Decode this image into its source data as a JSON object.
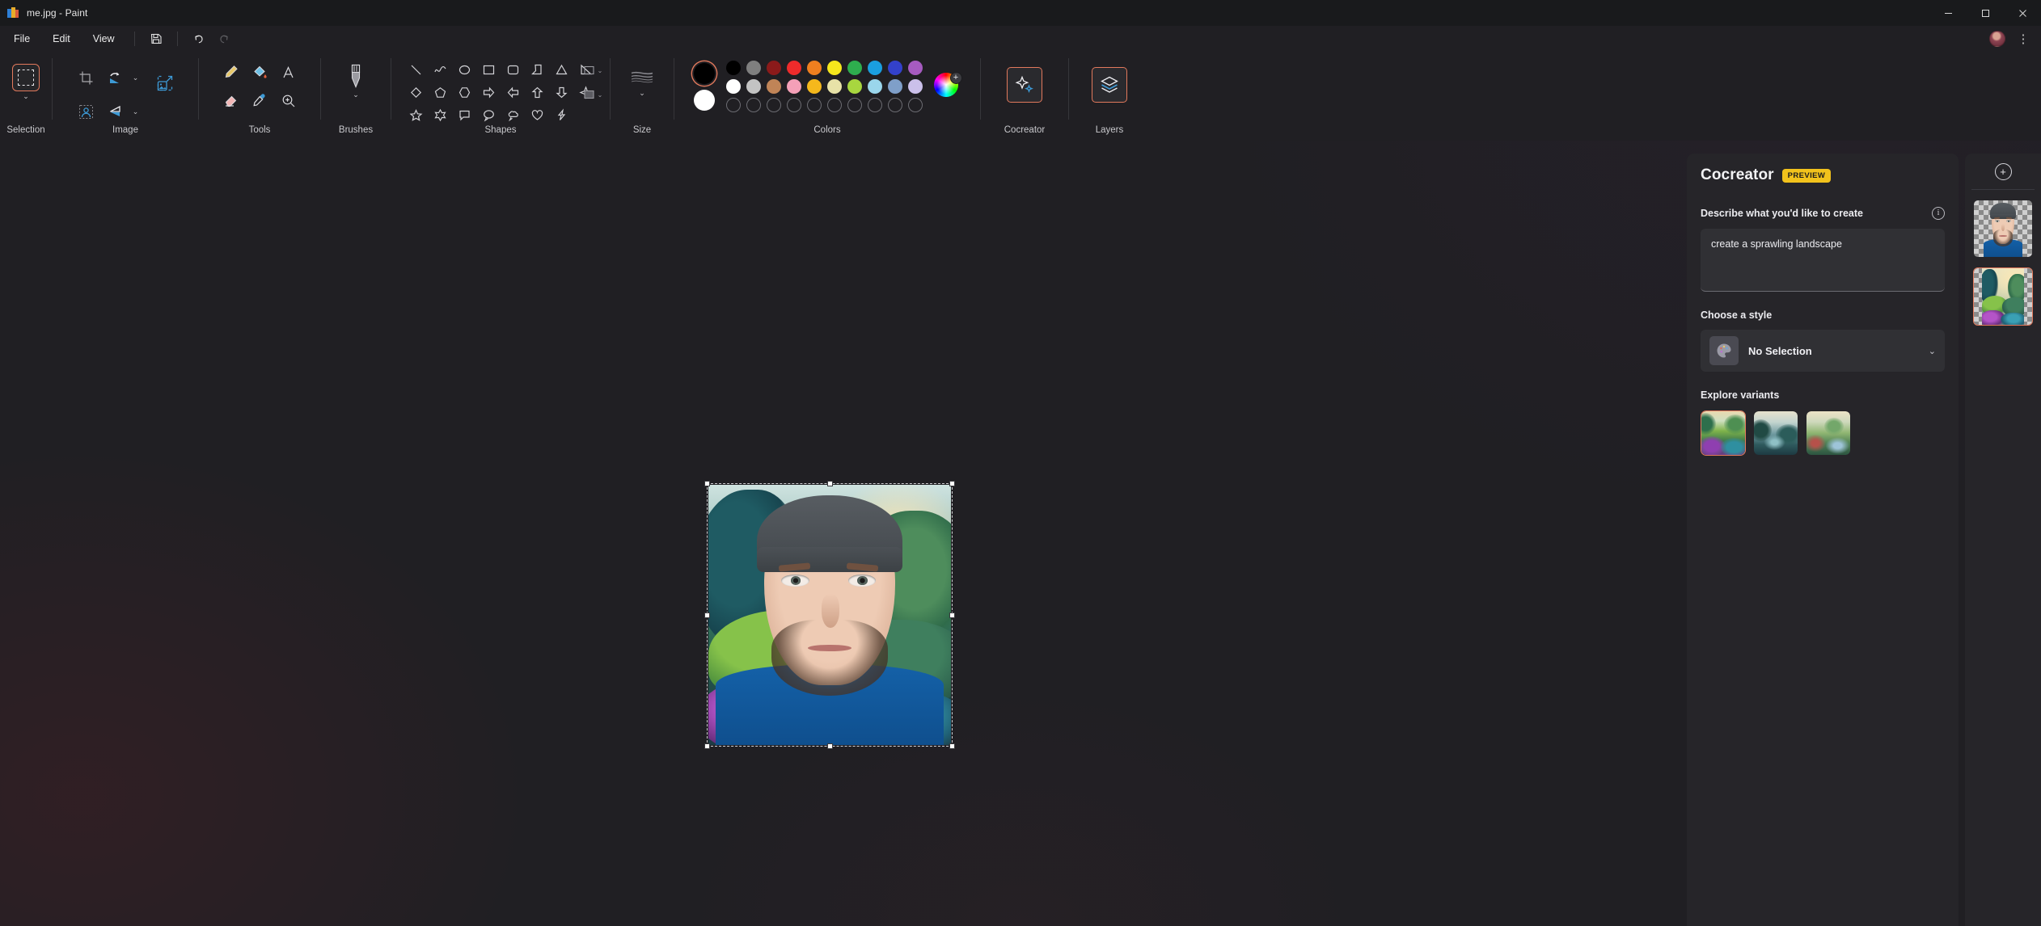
{
  "window": {
    "title": "me.jpg - Paint",
    "app_icon": "paint-icon",
    "controls": [
      {
        "name": "minimize",
        "glyph": "minimize-icon"
      },
      {
        "name": "maximize",
        "glyph": "maximize-icon"
      },
      {
        "name": "close",
        "glyph": "close-icon"
      }
    ]
  },
  "menubar": {
    "items": [
      {
        "label": "File",
        "name": "menu-file"
      },
      {
        "label": "Edit",
        "name": "menu-edit"
      },
      {
        "label": "View",
        "name": "menu-view"
      }
    ],
    "buttons": [
      {
        "name": "save-button",
        "icon": "save-icon",
        "enabled": true
      },
      {
        "name": "undo-button",
        "icon": "undo-icon",
        "enabled": true
      },
      {
        "name": "redo-button",
        "icon": "redo-icon",
        "enabled": false
      }
    ],
    "overflow_label": "⋮",
    "avatar": "account-avatar"
  },
  "ribbon": {
    "groups": [
      {
        "label": "Selection",
        "name": "ribbon-group-selection",
        "tools": [
          {
            "name": "rectangle-select-tool",
            "icon": "dashed-rectangle-icon",
            "selected": true
          }
        ]
      },
      {
        "label": "Image",
        "name": "ribbon-group-image",
        "tools": [
          {
            "name": "crop-tool",
            "icon": "crop-icon"
          },
          {
            "name": "rotate-tool",
            "icon": "rotate-icon",
            "has_chevron": true
          },
          {
            "name": "resize-image-tool",
            "icon": "resize-image-icon"
          },
          {
            "name": "remove-background-tool",
            "icon": "remove-background-icon"
          },
          {
            "name": "flip-tool",
            "icon": "flip-icon",
            "has_chevron": true
          }
        ]
      },
      {
        "label": "Tools",
        "name": "ribbon-group-tools",
        "tools": [
          {
            "name": "pencil-tool",
            "icon": "pencil-icon"
          },
          {
            "name": "fill-tool",
            "icon": "paint-bucket-icon"
          },
          {
            "name": "text-tool",
            "icon": "text-a-icon"
          },
          {
            "name": "eraser-tool",
            "icon": "eraser-icon"
          },
          {
            "name": "eyedropper-tool",
            "icon": "eyedropper-icon"
          },
          {
            "name": "magnifier-tool",
            "icon": "magnifier-icon"
          }
        ]
      },
      {
        "label": "Brushes",
        "name": "ribbon-group-brushes",
        "tools": [
          {
            "name": "brushes-tool",
            "icon": "brush-icon",
            "has_chevron": true
          }
        ]
      },
      {
        "label": "Shapes",
        "name": "ribbon-group-shapes",
        "shapes": [
          "line-shape",
          "curve-shape",
          "oval-shape",
          "rectangle-shape",
          "rounded-rectangle-shape",
          "polygon-shape",
          "triangle-shape",
          "right-triangle-shape",
          "diamond-shape",
          "pentagon-shape",
          "hexagon-shape",
          "arrow-right-shape",
          "arrow-left-shape",
          "arrow-up-shape",
          "arrow-down-shape",
          "four-point-star-shape",
          "five-point-star-shape",
          "six-point-star-shape",
          "rounded-callout-shape",
          "oval-callout-shape",
          "cloud-callout-shape",
          "heart-shape",
          "lightning-shape"
        ],
        "outline_label": "",
        "fill_label": ""
      },
      {
        "label": "Size",
        "name": "ribbon-group-size",
        "tools": [
          {
            "name": "size-tool",
            "icon": "brush-size-icon",
            "has_chevron": true
          }
        ]
      },
      {
        "label": "Colors",
        "name": "ribbon-group-colors",
        "primary_color": "#000000",
        "secondary_color": "#ffffff",
        "palette_rows": [
          [
            "#000000",
            "#7f7f7f",
            "#8b1a1a",
            "#ee2b2b",
            "#ef7f1f",
            "#f5e71c",
            "#2eae4e",
            "#1a9fe0",
            "#3341cb",
            "#a65bc0"
          ],
          [
            "#ffffff",
            "#c3c3c3",
            "#c08457",
            "#f4a0b8",
            "#f5b81c",
            "#e8e2a8",
            "#a8d63f",
            "#9ad6ec",
            "#7f9fc9",
            "#cbc0ea"
          ],
          [
            "",
            "",
            "",
            "",
            "",
            "",
            "",
            "",
            "",
            ""
          ]
        ],
        "edit_colors": "color-wheel-icon"
      },
      {
        "label": "Cocreator",
        "name": "ribbon-group-cocreator",
        "tools": [
          {
            "name": "cocreator-button",
            "icon": "sparkles-icon",
            "selected": true
          }
        ]
      },
      {
        "label": "Layers",
        "name": "ribbon-group-layers",
        "tools": [
          {
            "name": "layers-button",
            "icon": "layers-stack-icon",
            "selected": true
          }
        ]
      }
    ]
  },
  "canvas": {
    "selection": {
      "name": "image-selection",
      "handles": 8,
      "content_description": "portrait-over-landscape"
    }
  },
  "cocreator": {
    "title": "Cocreator",
    "badge": "PREVIEW",
    "prompt_label": "Describe what you'd like to create",
    "info_icon": "info-icon",
    "prompt_value": "create a sprawling landscape",
    "prompt_placeholder": "Describe what you'd like to create",
    "style_label": "Choose a style",
    "style_selected": "No Selection",
    "style_icon": "palette-icon",
    "style_chevron": "chevron-down-icon",
    "variants_label": "Explore variants",
    "variants": [
      {
        "name": "variant-1",
        "selected": true,
        "alt": "vivid-purple-green-landscape"
      },
      {
        "name": "variant-2",
        "selected": false,
        "alt": "misty-teal-valley-landscape"
      },
      {
        "name": "variant-3",
        "selected": false,
        "alt": "sunlit-river-valley-landscape"
      }
    ]
  },
  "layers_panel": {
    "add_layer_icon": "plus-circle-icon",
    "layers": [
      {
        "name": "layer-portrait",
        "selected": false,
        "alt": "portrait-photo-layer"
      },
      {
        "name": "layer-landscape",
        "selected": true,
        "alt": "generated-landscape-layer"
      }
    ]
  },
  "theme": {
    "accent": "#e2795c",
    "badge_yellow": "#f2c21c",
    "panel_bg": "#262529",
    "app_bg": "#201f23"
  }
}
